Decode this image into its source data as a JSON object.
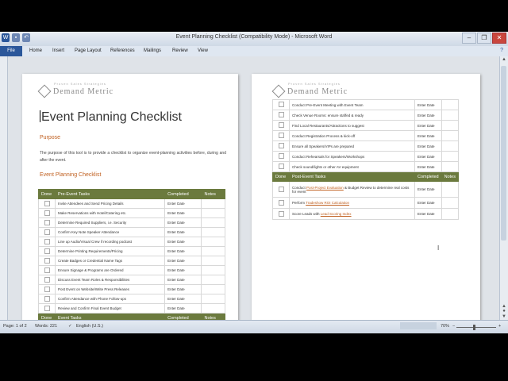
{
  "window": {
    "title": "Event Planning Checklist (Compatibility Mode)  -  Microsoft Word",
    "controls": [
      "–",
      "❐",
      "✕"
    ],
    "qat": [
      "W",
      "💾",
      "↶"
    ]
  },
  "ribbon": {
    "file": "File",
    "tabs": [
      "Home",
      "Insert",
      "Page Layout",
      "References",
      "Mailings",
      "Review",
      "View"
    ],
    "help": "?"
  },
  "page1": {
    "logo_tagline": "Proven Sales Strategies",
    "logo_text": "Demand Metric",
    "title": "Event Planning Checklist",
    "purpose_heading": "Purpose",
    "purpose_text": "The purpose of this tool is to provide a checklist to organize event-planning activities before, during and after the event.",
    "checklist_heading": "Event Planning Checklist",
    "headers": [
      "Done",
      "Pre-Event Tasks",
      "Completed",
      "Notes"
    ],
    "rows": [
      {
        "task": "Invite Attendees and Send Pricing Details",
        "completed": "Enter Date"
      },
      {
        "task": "Make Reservations with Hotel/Catering etc.",
        "completed": "Enter Date"
      },
      {
        "task": "Determine Required Suppliers, i.e. Security",
        "completed": "Enter Date"
      },
      {
        "task": "Confirm Key Note Speaker Attendance",
        "completed": "Enter Date"
      },
      {
        "task": "Line up Audio/Visual Crew if recording podcast",
        "completed": "Enter Date"
      },
      {
        "task": "Determine Printing Requirements/Pricing",
        "completed": "Enter Date"
      },
      {
        "task": "Create Badges or Credential Name Tags",
        "completed": "Enter Date"
      },
      {
        "task": "Ensure Signage & Programs are Ordered",
        "completed": "Enter Date"
      },
      {
        "task": "Discuss Event Team Roles & Responsibilities",
        "completed": "Enter Date"
      },
      {
        "task": "Post Event on Website/Write Press Releases",
        "completed": "Enter Date"
      },
      {
        "task": "Confirm Attendance with Phone Follow-ups",
        "completed": "Enter Date"
      },
      {
        "task": "Review and Confirm Final Event Budget",
        "completed": "Enter Date"
      }
    ],
    "footer_headers": [
      "Done",
      "Event Tasks",
      "Completed",
      "Notes"
    ]
  },
  "page2": {
    "logo_tagline": "Proven Sales Strategies",
    "logo_text": "Demand Metric",
    "rows": [
      {
        "task": "Conduct Pre-Event Meeting with Event Team",
        "completed": "Enter Date"
      },
      {
        "task": "Check Venue Rooms: ensure staffed & ready",
        "completed": "Enter Date"
      },
      {
        "task": "Find Local Restaurants/Attractions  to suggest",
        "completed": "Enter Date"
      },
      {
        "task": "Conduct Registration Process & kick-off",
        "completed": "Enter Date"
      },
      {
        "task": "Ensure all Speakers/VIPs are prepared",
        "completed": "Enter Date"
      },
      {
        "task": "Conduct Rehearsals for Speakers/Workshops",
        "completed": "Enter Date"
      },
      {
        "task": "Check sound/lights or other AV equipment",
        "completed": "Enter Date"
      }
    ],
    "post_headers": [
      "Done",
      "Post-Event Tasks",
      "Completed",
      "Notes"
    ],
    "post_rows": [
      {
        "pre": "Conduct ",
        "link": "Post-Project Evaluation",
        "post": " & Budget Review to determine real costs for event",
        "completed": "Enter Date"
      },
      {
        "pre": "Perform ",
        "link": "Tradeshow ROI Calculation",
        "post": "",
        "completed": "Enter Date"
      },
      {
        "pre": "Score Leads with ",
        "link": "Lead Scoring Index",
        "post": "",
        "completed": "Enter Date"
      }
    ]
  },
  "status": {
    "page": "Page: 1 of 2",
    "words": "Words: 221",
    "language": "English (U.S.)",
    "zoom": "70%",
    "zoom_minus": "−",
    "zoom_plus": "+"
  }
}
